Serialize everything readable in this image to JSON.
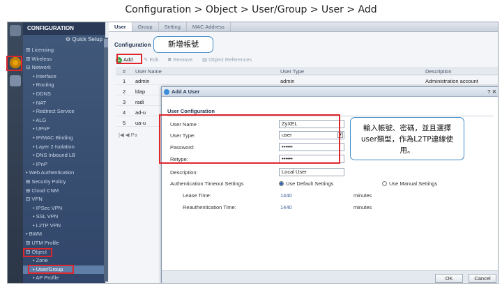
{
  "page_title": "Configuration > Object > User/Group > User > Add",
  "nav": {
    "header": "CONFIGURATION",
    "quick_setup": "Quick Setup",
    "items": [
      {
        "label": "⊞ Licensing",
        "level": 1
      },
      {
        "label": "⊞ Wireless",
        "level": 1
      },
      {
        "label": "⊟ Network",
        "level": 1
      },
      {
        "label": "• Interface",
        "level": 2
      },
      {
        "label": "• Routing",
        "level": 2
      },
      {
        "label": "• DDNS",
        "level": 2
      },
      {
        "label": "• NAT",
        "level": 2
      },
      {
        "label": "• Redirect Service",
        "level": 2
      },
      {
        "label": "• ALG",
        "level": 2
      },
      {
        "label": "• UPnP",
        "level": 2
      },
      {
        "label": "• IP/MAC Binding",
        "level": 2
      },
      {
        "label": "• Layer 2 Isolation",
        "level": 2
      },
      {
        "label": "• DNS Inbound LB",
        "level": 2
      },
      {
        "label": "• IPnP",
        "level": 2
      },
      {
        "label": "• Web Authentication",
        "level": 1
      },
      {
        "label": "⊞ Security Policy",
        "level": 1
      },
      {
        "label": "⊞ Cloud CNM",
        "level": 1
      },
      {
        "label": "⊟ VPN",
        "level": 1
      },
      {
        "label": "• IPSec VPN",
        "level": 2
      },
      {
        "label": "• SSL VPN",
        "level": 2
      },
      {
        "label": "• L2TP VPN",
        "level": 2
      },
      {
        "label": "• BWM",
        "level": 1
      },
      {
        "label": "⊞ UTM Profile",
        "level": 1
      },
      {
        "label": "⊟ Object",
        "level": 1
      },
      {
        "label": "• Zone",
        "level": 2
      },
      {
        "label": "• User/Group",
        "level": 2,
        "selected": true
      },
      {
        "label": "• AP Profile",
        "level": 2
      }
    ]
  },
  "tabs": [
    "User",
    "Group",
    "Setting",
    "MAC Address"
  ],
  "section_title": "Configuration",
  "toolbar": {
    "add": "Add",
    "edit": "Edit",
    "remove": "Remove",
    "object_refs": "Object References"
  },
  "table": {
    "headers": [
      "#",
      "User Name",
      "User Type",
      "Description"
    ],
    "rows": [
      {
        "num": "1",
        "name": "admin",
        "type": "admin",
        "desc": "Administration account"
      },
      {
        "num": "2",
        "name": "ldap",
        "type": "",
        "desc": ""
      },
      {
        "num": "3",
        "name": "radi",
        "type": "",
        "desc": ""
      },
      {
        "num": "4",
        "name": "ad-u",
        "type": "",
        "desc": ""
      },
      {
        "num": "5",
        "name": "ua-u",
        "type": "",
        "desc": ""
      }
    ],
    "pager": "|◀ ◀ Pa"
  },
  "dialog": {
    "title": "Add A User",
    "controls": "? ✕",
    "config_title": "User Configuration",
    "username_label": "User Name :",
    "username_value": "ZyXEL",
    "usertype_label": "User Type:",
    "usertype_value": "user",
    "password_label": "Password:",
    "password_value": "••••••",
    "retype_label": "Retype:",
    "retype_value": "••••••",
    "description_label": "Description:",
    "description_value": "Local User",
    "timeout_label": "Authentication Timeout Settings",
    "use_default": "Use Default Settings",
    "use_manual": "Use Manual Settings",
    "lease_label": "Lease Time:",
    "lease_value": "1440",
    "lease_unit": "minutes",
    "reauth_label": "Reauthentication Time:",
    "reauth_value": "1440",
    "reauth_unit": "minutes",
    "ok": "OK",
    "cancel": "Cancel"
  },
  "callouts": {
    "add_account": "新增帳號",
    "instructions": "輸入帳號、密碼，並且選擇user類型，作為L2TP連線使用。"
  },
  "colors": {
    "highlight": "#e0262d",
    "callout_border": "#3c8ac9",
    "nav_bg": "#31466a"
  }
}
